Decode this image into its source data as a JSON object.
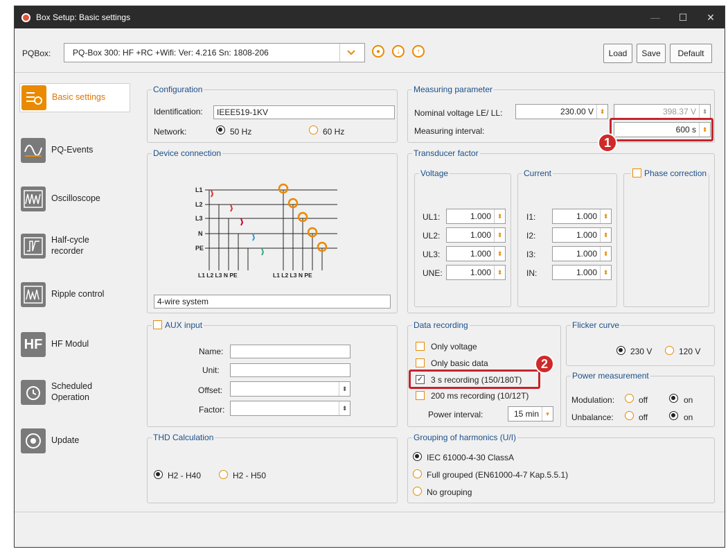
{
  "window": {
    "title": "Box Setup: Basic settings"
  },
  "toolbar": {
    "pqbox_label": "PQBox:",
    "device": "PQ-Box 300: HF +RC +Wifi: Ver: 4.216 Sn: 1808-206",
    "load": "Load",
    "save": "Save",
    "default": "Default"
  },
  "sidebar": {
    "items": [
      {
        "label": "Basic settings",
        "icon": "basic-settings-icon"
      },
      {
        "label": "PQ-Events",
        "icon": "pq-events-icon"
      },
      {
        "label": "Oscilloscope",
        "icon": "oscilloscope-icon"
      },
      {
        "label": "Half-cycle recorder",
        "icon": "half-cycle-icon"
      },
      {
        "label": "Ripple control",
        "icon": "ripple-control-icon"
      },
      {
        "label": "HF Modul",
        "icon": "hf-modul-icon"
      },
      {
        "label": "Scheduled Operation",
        "icon": "scheduled-icon"
      },
      {
        "label": "Update",
        "icon": "update-icon"
      }
    ]
  },
  "configuration": {
    "title": "Configuration",
    "id_label": "Identification:",
    "id_value": "IEEE519-1KV",
    "network_label": "Network:",
    "opt_50": "50 Hz",
    "opt_60": "60 Hz",
    "selected": "50 Hz"
  },
  "measuring": {
    "title": "Measuring parameter",
    "nominal_label": "Nominal voltage LE/ LL:",
    "nominal_le": "230.00 V",
    "nominal_ll": "398.37 V",
    "interval_label": "Measuring interval:",
    "interval_value": "600 s"
  },
  "device": {
    "title": "Device connection",
    "system": "4-wire system",
    "lines": [
      "L1",
      "L2",
      "L3",
      "N",
      "PE"
    ],
    "bottom_labels_left": "L1 L2 L3  N  PE",
    "bottom_labels_right": "L1 L2 L3  N  PE"
  },
  "transducer": {
    "title": "Transducer factor",
    "voltage_title": "Voltage",
    "current_title": "Current",
    "phase_title": "Phase correction",
    "voltage": [
      {
        "label": "UL1:",
        "value": "1.000"
      },
      {
        "label": "UL2:",
        "value": "1.000"
      },
      {
        "label": "UL3:",
        "value": "1.000"
      },
      {
        "label": "UNE:",
        "value": "1.000"
      }
    ],
    "current": [
      {
        "label": "I1:",
        "value": "1.000"
      },
      {
        "label": "I2:",
        "value": "1.000"
      },
      {
        "label": "I3:",
        "value": "1.000"
      },
      {
        "label": "IN:",
        "value": "1.000"
      }
    ]
  },
  "aux": {
    "title": "AUX input",
    "name_label": "Name:",
    "unit_label": "Unit:",
    "offset_label": "Offset:",
    "factor_label": "Factor:"
  },
  "data_recording": {
    "title": "Data recording",
    "only_voltage": "Only voltage",
    "only_basic": "Only basic data",
    "rec_3s": "3 s recording (150/180T)",
    "rec_200ms": "200 ms recording (10/12T)",
    "power_interval_label": "Power interval:",
    "power_interval_value": "15 min"
  },
  "flicker": {
    "title": "Flicker curve",
    "opt_230": "230 V",
    "opt_120": "120 V",
    "selected": "230 V"
  },
  "power_measurement": {
    "title": "Power measurement",
    "modulation_label": "Modulation:",
    "unbalance_label": "Unbalance:",
    "off": "off",
    "on": "on"
  },
  "thd": {
    "title": "THD Calculation",
    "opt_40": "H2 - H40",
    "opt_50": "H2 - H50",
    "selected": "H2 - H40"
  },
  "harmonics": {
    "title": "Grouping of harmonics (U/I)",
    "opt_1": "IEC 61000-4-30 ClassA",
    "opt_2": "Full grouped (EN61000-4-7 Kap.5.5.1)",
    "opt_3": "No grouping",
    "selected": "IEC 61000-4-30 ClassA"
  },
  "annotations": {
    "badge1": "1",
    "badge2": "2"
  },
  "colors": {
    "accent": "#e98a00",
    "highlight": "#c4242c",
    "group_title": "#1b4f8a"
  }
}
